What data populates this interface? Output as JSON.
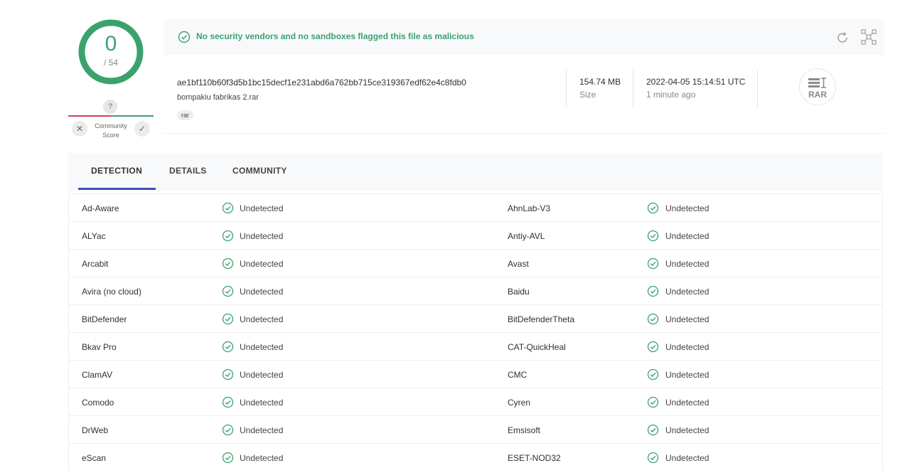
{
  "score": {
    "value": "0",
    "total": "/ 54",
    "color": "#3ba26f"
  },
  "community": {
    "question": "?",
    "label_line1": "Community",
    "label_line2": "Score",
    "down": "✕",
    "up": "✓"
  },
  "banner": {
    "message": "No security vendors and no sandboxes flagged this file as malicious"
  },
  "file": {
    "hash": "ae1bf110b60f3d5b1bc15decf1e231abd6a762bb715ce319367edf62e4c8fdb0",
    "name": "bompakiu fabrikas 2.rar",
    "tag": "rar",
    "size_value": "154.74 MB",
    "size_label": "Size",
    "date_value": "2022-04-05 15:14:51 UTC",
    "date_label": "1 minute ago",
    "type_icon": "RAR"
  },
  "tabs": [
    {
      "label": "DETECTION",
      "active": true
    },
    {
      "label": "DETAILS",
      "active": false
    },
    {
      "label": "COMMUNITY",
      "active": false
    }
  ],
  "detections": [
    {
      "engine1": "Ad-Aware",
      "result1": "Undetected",
      "engine2": "AhnLab-V3",
      "result2": "Undetected"
    },
    {
      "engine1": "ALYac",
      "result1": "Undetected",
      "engine2": "Antiy-AVL",
      "result2": "Undetected"
    },
    {
      "engine1": "Arcabit",
      "result1": "Undetected",
      "engine2": "Avast",
      "result2": "Undetected"
    },
    {
      "engine1": "Avira (no cloud)",
      "result1": "Undetected",
      "engine2": "Baidu",
      "result2": "Undetected"
    },
    {
      "engine1": "BitDefender",
      "result1": "Undetected",
      "engine2": "BitDefenderTheta",
      "result2": "Undetected"
    },
    {
      "engine1": "Bkav Pro",
      "result1": "Undetected",
      "engine2": "CAT-QuickHeal",
      "result2": "Undetected"
    },
    {
      "engine1": "ClamAV",
      "result1": "Undetected",
      "engine2": "CMC",
      "result2": "Undetected"
    },
    {
      "engine1": "Comodo",
      "result1": "Undetected",
      "engine2": "Cyren",
      "result2": "Undetected"
    },
    {
      "engine1": "DrWeb",
      "result1": "Undetected",
      "engine2": "Emsisoft",
      "result2": "Undetected"
    },
    {
      "engine1": "eScan",
      "result1": "Undetected",
      "engine2": "ESET-NOD32",
      "result2": "Undetected"
    }
  ],
  "colors": {
    "clean": "#3ba26f",
    "malicious": "#d4425a",
    "tab_accent": "#3f51b5"
  },
  "icons": {
    "banner": "check-circle-icon",
    "reload": "reload-icon",
    "graph": "graph-icon",
    "result": "check-circle-icon",
    "filetype": "rar-file-icon"
  }
}
